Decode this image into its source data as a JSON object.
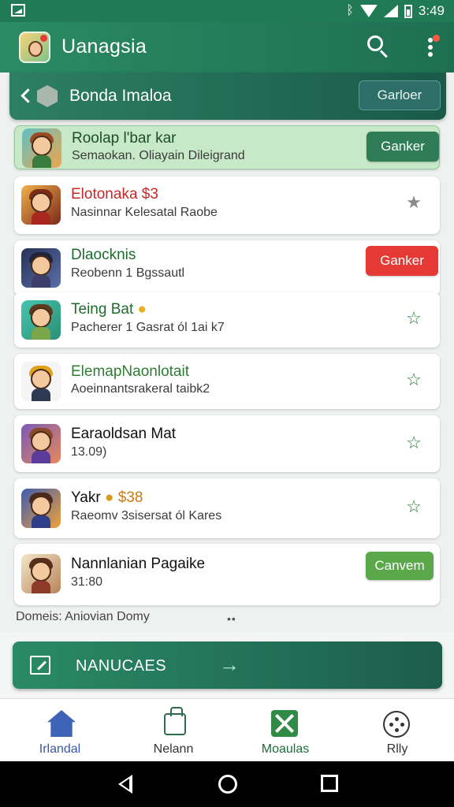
{
  "status_bar": {
    "time": "3:49",
    "bluetooth": "ᛒ"
  },
  "app_bar": {
    "title": "Uanagsia",
    "logo_icon": "app-logo-icon",
    "search_icon": "search-icon",
    "more_icon": "more-vert-icon"
  },
  "subheader": {
    "title": "Bonda Imaloa",
    "action_label": "Garloer"
  },
  "items": [
    {
      "name": "Roolap l'bar kar",
      "subtitle": "Semaokan. Oliayain Dileigrand",
      "action": "Ganker",
      "action_type": "button",
      "name_color": "#1c4d27",
      "highlight": true
    },
    {
      "name": "Elotonaka $3",
      "subtitle": "Nasinnar Kelesatal Raobe",
      "action": "★",
      "action_type": "star",
      "name_color": "#c62828",
      "star_color": "#8a8a8a"
    },
    {
      "name": "Dlaocknis",
      "subtitle": "Reobenn 1 Bgssautl",
      "action": "Ganker",
      "action_type": "button-red",
      "name_color": "#1e6b2f"
    },
    {
      "name": "Teing Bat",
      "subtitle": "Pacherer 1 Gasrat ól 1ai k7",
      "action": "☆",
      "action_type": "star",
      "name_color": "#1e6b2f",
      "star_color": "#2e7d32"
    },
    {
      "name": "ElemapNaonlotait",
      "subtitle": "Aoeinnantsrakeral taibk2",
      "action": "☆",
      "action_type": "star",
      "name_color": "#2e7d32",
      "star_color": "#2e7d32"
    },
    {
      "name": "Earaoldsan Mat",
      "subtitle": "13.09)",
      "action": "☆",
      "action_type": "star",
      "name_color": "#111111",
      "star_color": "#2e7d32"
    },
    {
      "name": "Yakr",
      "name_badge": "$38",
      "subtitle": "Raeomv 3sisersat ól Kares",
      "action": "☆",
      "action_type": "star",
      "name_color": "#111111",
      "star_color": "#2e7d32"
    },
    {
      "name": "Nannlanian Pagaike",
      "subtitle": "31:80",
      "action": "Canvem",
      "action_type": "button-green",
      "name_color": "#111111"
    }
  ],
  "colors": {
    "button_dark_green": "#2f7d57",
    "button_red": "#e53935",
    "button_green": "#5aa84a"
  },
  "footer": {
    "note": "Domeis: Aniovian Domy",
    "dots": "••"
  },
  "banner": {
    "label": "NANUCAES",
    "arrow": "→"
  },
  "bottom_nav": [
    {
      "label": "Irlandal",
      "icon": "home-icon"
    },
    {
      "label": "Nelann",
      "icon": "bag-icon"
    },
    {
      "label": "Moaulas",
      "icon": "modules-icon"
    },
    {
      "label": "Rlly",
      "icon": "dice-icon"
    }
  ]
}
